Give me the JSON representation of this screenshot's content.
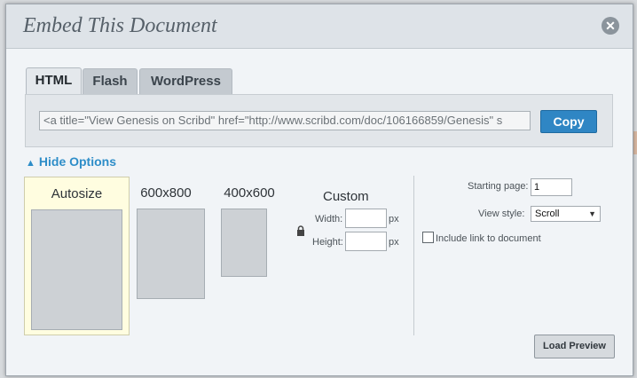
{
  "dialog": {
    "title": "Embed This Document",
    "close_icon": "close-icon"
  },
  "tabs": [
    {
      "label": "HTML",
      "active": true
    },
    {
      "label": "Flash",
      "active": false
    },
    {
      "label": "WordPress",
      "active": false
    }
  ],
  "embed": {
    "code": "<a title=\"View Genesis on Scribd\" href=\"http://www.scribd.com/doc/106166859/Genesis\" s",
    "copy_label": "Copy"
  },
  "options": {
    "toggle_label": "Hide Options",
    "toggle_icon": "triangle-up-icon",
    "sizes": [
      {
        "label": "Autosize",
        "selected": true
      },
      {
        "label": "600x800",
        "selected": false
      },
      {
        "label": "400x600",
        "selected": false
      }
    ],
    "custom": {
      "label": "Custom",
      "width_label": "Width:",
      "height_label": "Height:",
      "unit": "px",
      "width_value": "",
      "height_value": "",
      "lock_icon": "lock-icon"
    },
    "starting_page_label": "Starting page:",
    "starting_page_value": "1",
    "view_style_label": "View style:",
    "view_style_value": "Scroll",
    "include_link_label": "Include link to document",
    "include_link_checked": false,
    "load_preview_label": "Load Preview"
  },
  "colors": {
    "accent": "#2f86c4",
    "link": "#2d8dc8",
    "selected_size_bg": "#fffde0"
  }
}
